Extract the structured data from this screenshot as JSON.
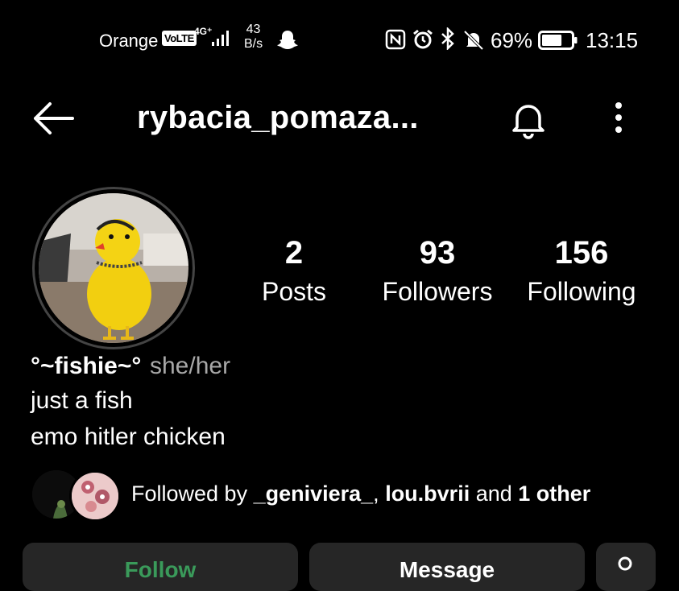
{
  "status_bar": {
    "carrier": "Orange",
    "volte": "VoLTE",
    "network_type": "4G⁺",
    "speed_value": "43",
    "speed_unit": "B/s",
    "battery_percent": "69%",
    "battery_level": 0.69,
    "time": "13:15"
  },
  "header": {
    "username": "rybacia_pomaza..."
  },
  "stats": [
    {
      "value": "2",
      "label": "Posts"
    },
    {
      "value": "93",
      "label": "Followers"
    },
    {
      "value": "156",
      "label": "Following"
    }
  ],
  "bio": {
    "display_name": "°~fishie~°",
    "pronouns": "she/her",
    "lines": [
      "just a fish",
      "emo hitler chicken"
    ]
  },
  "followed_by": {
    "prefix": "Followed by ",
    "user1": "_geniviera_",
    "sep": ", ",
    "user2": "lou.bvrii",
    "and": " and ",
    "others": "1 other"
  },
  "buttons": {
    "follow": "Follow",
    "message": "Message"
  }
}
